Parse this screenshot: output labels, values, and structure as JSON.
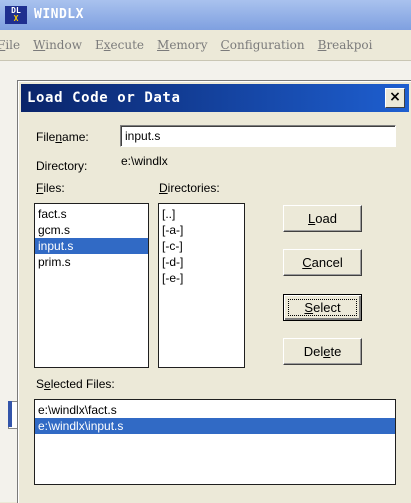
{
  "app": {
    "title": "WINDLX",
    "icon_top": "DL",
    "icon_bottom": "X"
  },
  "menu": [
    "File",
    "Window",
    "Execute",
    "Memory",
    "Configuration",
    "Breakpoi"
  ],
  "dialog": {
    "title": "Load Code or Data",
    "close_glyph": "×",
    "filename_label": "Filename:",
    "filename_value": "input.s",
    "directory_label": "Directory:",
    "directory_value": "e:\\windlx",
    "files_label": "Files:",
    "files": [
      "fact.s",
      "gcm.s",
      "input.s",
      "prim.s"
    ],
    "files_selected": "input.s",
    "directories_label": "Directories:",
    "directories": [
      "[..]",
      "[-a-]",
      "[-c-]",
      "[-d-]",
      "[-e-]"
    ],
    "buttons": {
      "load": "Load",
      "cancel": "Cancel",
      "select": "Select",
      "delete": "Delete"
    },
    "selected_files_label": "Selected Files:",
    "selected_files": [
      "e:\\windlx\\fact.s",
      "e:\\windlx\\input.s"
    ],
    "selected_files_highlight": "e:\\windlx\\input.s"
  }
}
